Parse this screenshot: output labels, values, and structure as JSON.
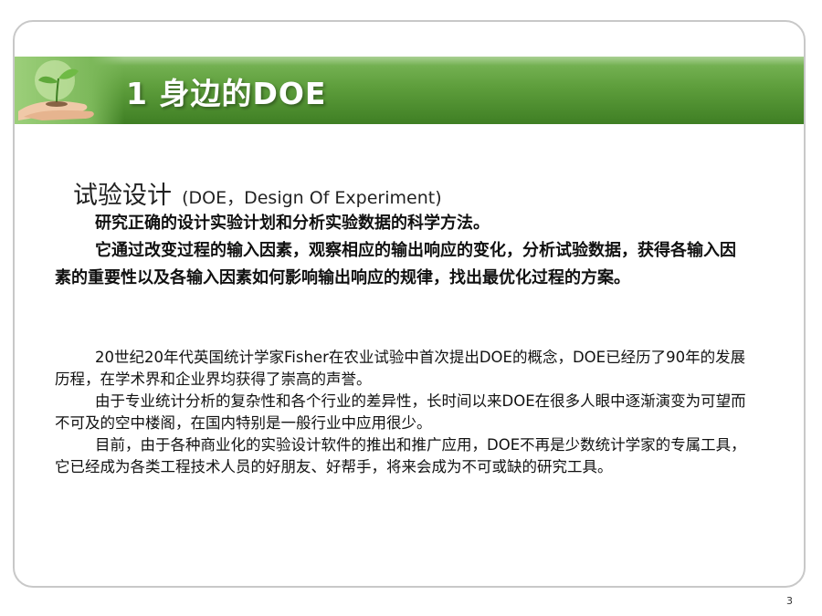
{
  "slide": {
    "title": "1 身边的DOE",
    "page_number": "3"
  },
  "section": {
    "heading": "试验设计",
    "heading_subtitle": "(DOE，Design Of Experiment)"
  },
  "bold_paragraphs": [
    "研究正确的设计实验计划和分析实验数据的科学方法。",
    "它通过改变过程的输入因素，观察相应的输出响应的变化，分析试验数据，获得各输入因素的重要性以及各输入因素如何影响输出响应的规律，找出最优化过程的方案。"
  ],
  "paragraphs": [
    "20世纪20年代英国统计学家Fisher在农业试验中首次提出DOE的概念，DOE已经历了90年的发展历程，在学术界和企业界均获得了崇高的声誉。",
    "由于专业统计分析的复杂性和各个行业的差异性，长时间以来DOE在很多人眼中逐渐演变为可望而不可及的空中楼阁，在国内特别是一般行业中应用很少。",
    "目前，由于各种商业化的实验设计软件的推出和推广应用，DOE不再是少数统计学家的专属工具，它已经成为各类工程技术人员的好朋友、好帮手，将来会成为不可或缺的研究工具。"
  ],
  "colors": {
    "banner_green": "#5e9e3c",
    "border_gray": "#c8c8c8",
    "text": "#111111"
  },
  "icons": {
    "banner_image": "seedling-in-hands-icon"
  }
}
